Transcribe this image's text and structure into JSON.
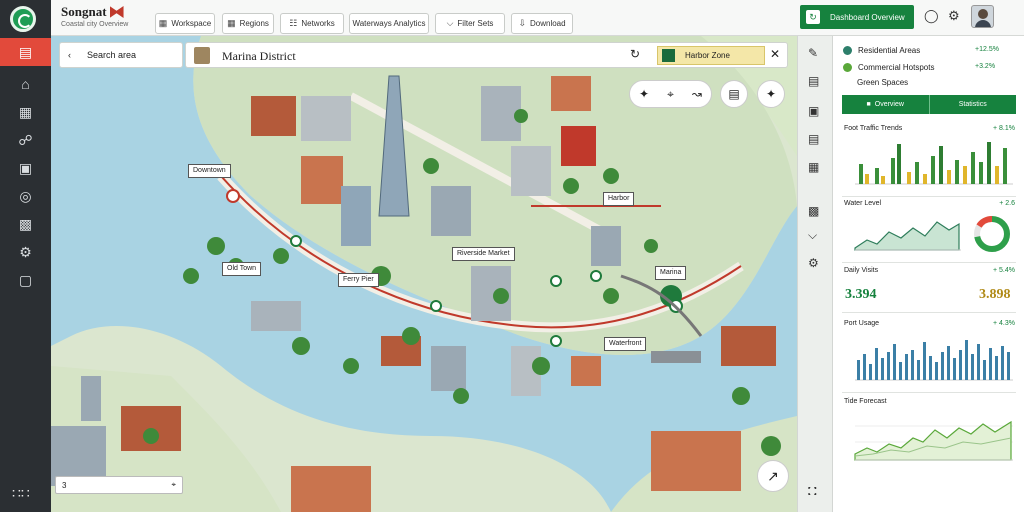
{
  "app": {
    "title": "Songnat",
    "subtitle": "Coastal city Overview"
  },
  "toolbar": {
    "buttons": [
      {
        "label": "Workspace",
        "icon": "workspace-icon"
      },
      {
        "label": "Regions",
        "icon": "grid-icon"
      },
      {
        "label": "Networks",
        "icon": "network-icon"
      },
      {
        "label": "Waterways Analytics",
        "icon": "droplet-icon"
      },
      {
        "label": "Filter Sets",
        "icon": "filter-icon"
      },
      {
        "label": "Download",
        "icon": "download-icon"
      }
    ],
    "primary_label": "Dashboard Overview"
  },
  "map": {
    "search_label": "Search area",
    "title": "Marina District",
    "chip_label": "Harbor Zone",
    "labels": [
      "Downtown",
      "Old Town",
      "Ferry Pier",
      "Harbor",
      "Riverside Market",
      "Marina",
      "Waterfront"
    ],
    "bottom_value": "3"
  },
  "legend": [
    {
      "label": "Residential Areas",
      "value": "+12.5%",
      "color": "#2d7f6b"
    },
    {
      "label": "Commercial Hotspots",
      "value": "+3.2%",
      "color": "#5aa83a"
    },
    {
      "label": "Green Spaces",
      "value": "",
      "color": ""
    }
  ],
  "panel_tabs": [
    "Overview",
    "Statistics"
  ],
  "sections": {
    "traffic_title": "Foot Traffic Trends",
    "traffic_value": "+ 8.1%",
    "water_title": "Water Level",
    "water_value": "+ 2.6",
    "donut_fraction": 0.72,
    "metrics_title": "Daily Visits",
    "metrics_value": "+ 5.4%",
    "metric_a": "3.394",
    "metric_b": "3.898",
    "usage_title": "Port Usage",
    "usage_value": "+ 4.3%",
    "trend_title": "Tide Forecast"
  },
  "colors": {
    "accent": "#16823e",
    "alert": "#e24a3b",
    "water": "#a9d3e3"
  }
}
